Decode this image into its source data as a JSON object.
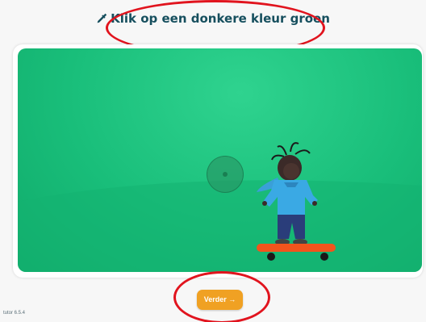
{
  "instruction": {
    "icon": "color-picker-icon",
    "text": "Klik op een donkere kleur groen"
  },
  "scene": {
    "backdrop_color": "#19be7a",
    "figure": "doll-on-skateboard"
  },
  "button": {
    "label": "Verder →"
  },
  "version": "tutor 6.5.4",
  "colors": {
    "title": "#164f5e",
    "button": "#f0a123",
    "annotation_ring": "#e1141e"
  }
}
